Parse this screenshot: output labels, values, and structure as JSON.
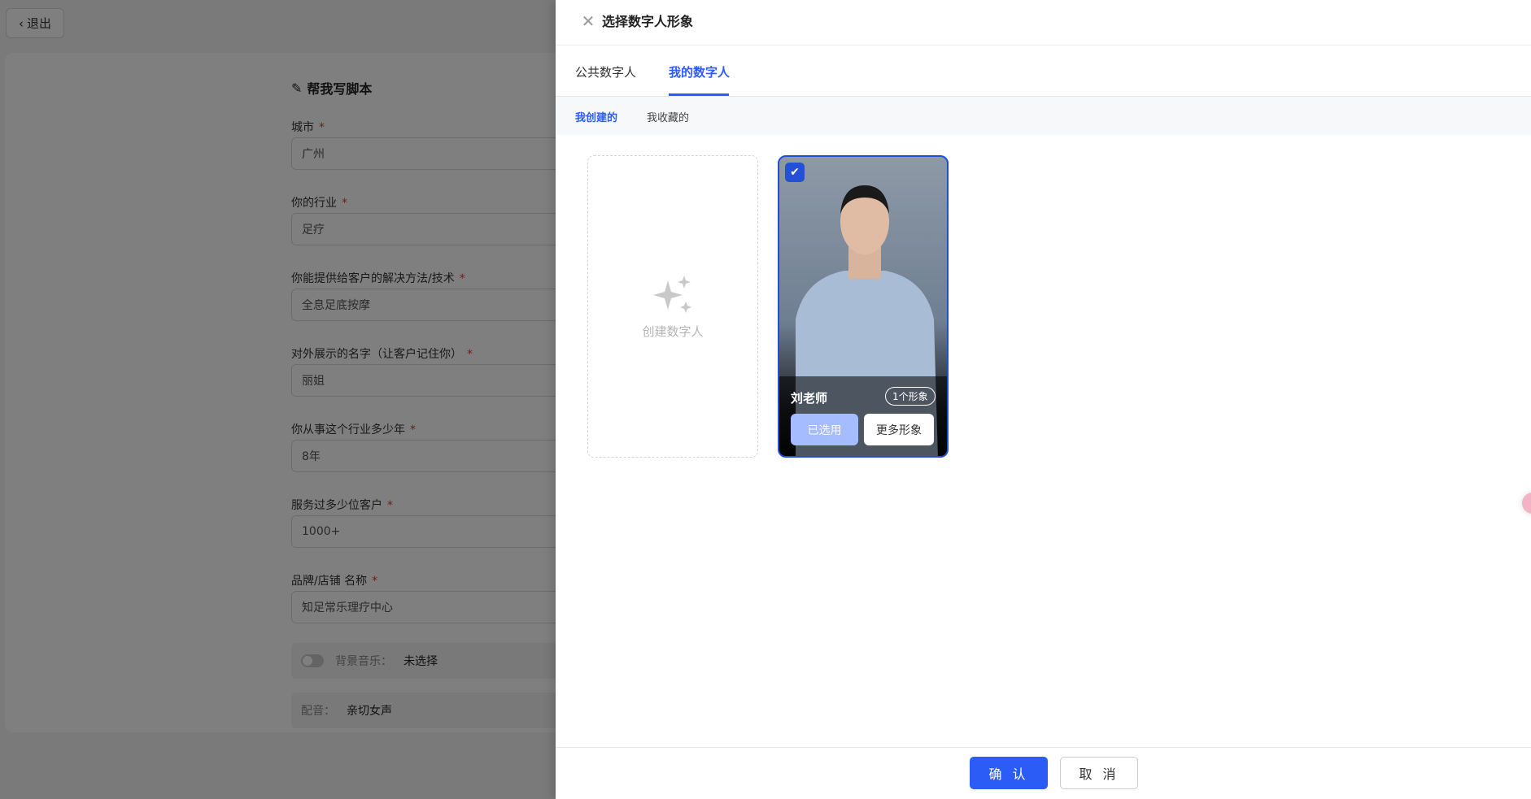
{
  "page": {
    "exit_label": "退出",
    "form_title": "帮我写脚本",
    "fields": [
      {
        "label": "城市",
        "value": "广州"
      },
      {
        "label": "你的行业",
        "value": "足疗"
      },
      {
        "label": "你能提供给客户的解决方法/技术",
        "value": "全息足底按摩"
      },
      {
        "label": "对外展示的名字（让客户记住你）",
        "value": "丽姐"
      },
      {
        "label": "你从事这个行业多少年",
        "value": "8年"
      },
      {
        "label": "服务过多少位客户",
        "value": "1000+"
      },
      {
        "label": "品牌/店铺 名称",
        "value": "知足常乐理疗中心"
      }
    ],
    "required_mark": "*",
    "bg_music": {
      "label": "背景音乐：",
      "value": "未选择",
      "enabled": false
    },
    "voice": {
      "label": "配音：",
      "value": "亲切女声"
    }
  },
  "drawer": {
    "title": "选择数字人形象",
    "tabs": [
      {
        "label": "公共数字人",
        "active": false
      },
      {
        "label": "我的数字人",
        "active": true
      }
    ],
    "subtabs": [
      {
        "label": "我创建的",
        "active": true
      },
      {
        "label": "我收藏的",
        "active": false
      }
    ],
    "create_label": "创建数字人",
    "avatar": {
      "name": "刘老师",
      "count_badge": "1个形象",
      "selected": true,
      "used_label": "已选用",
      "more_label": "更多形象"
    },
    "confirm_label": "确 认",
    "cancel_label": "取 消"
  },
  "colors": {
    "accent": "#2b5cf6",
    "used_button": "#a5bcff"
  }
}
